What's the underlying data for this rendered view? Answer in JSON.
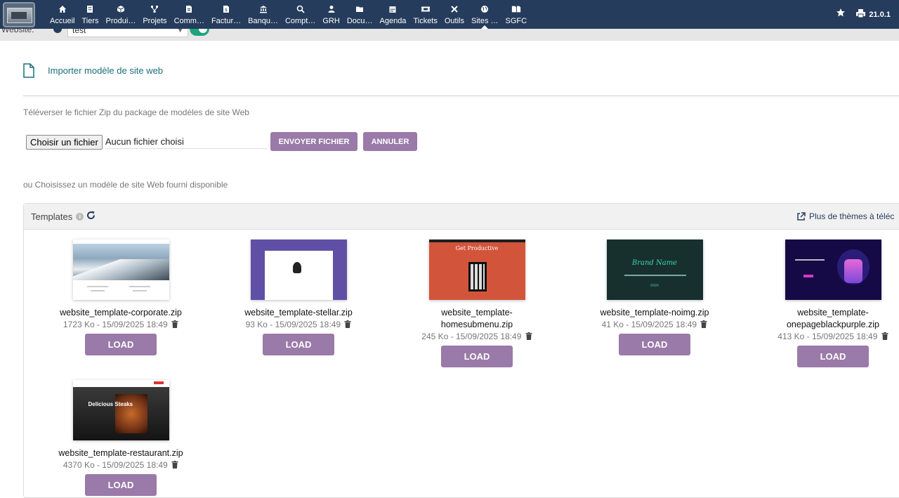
{
  "menu": [
    {
      "label": "Accueil",
      "icon": "home-icon"
    },
    {
      "label": "Tiers",
      "icon": "building-icon"
    },
    {
      "label": "Produi…",
      "icon": "cube-icon"
    },
    {
      "label": "Projets",
      "icon": "sitemap-icon"
    },
    {
      "label": "Comm…",
      "icon": "file-invoice-icon"
    },
    {
      "label": "Factur…",
      "icon": "file-dollar-icon"
    },
    {
      "label": "Banqu…",
      "icon": "bank-icon"
    },
    {
      "label": "Compt…",
      "icon": "search-dollar-icon"
    },
    {
      "label": "GRH",
      "icon": "user-icon"
    },
    {
      "label": "Docu…",
      "icon": "folder-icon"
    },
    {
      "label": "Agenda",
      "icon": "calendar-icon"
    },
    {
      "label": "Tickets",
      "icon": "ticket-icon"
    },
    {
      "label": "Outils",
      "icon": "tools-icon"
    },
    {
      "label": "Sites …",
      "icon": "globe-icon"
    },
    {
      "label": "SGFC",
      "icon": "files-icon"
    }
  ],
  "active_menu": "Sites …",
  "topright": {
    "version": "21.0.1"
  },
  "subbar": {
    "website_label": "Website:",
    "website_value": "test"
  },
  "page": {
    "title": "Importer modèle de site web",
    "upload_hint": "Téléverser le fichier Zip du package de modèles de site Web",
    "file_button": "Choisir un fichier",
    "file_status": "Aucun fichier choisi",
    "send_button": "ENVOYER FICHIER",
    "cancel_button": "ANNULER",
    "choose_hint": "ou Choisissez un modèle de site Web fourni disponible"
  },
  "templates": {
    "header": "Templates",
    "more_themes": "Plus de thèmes à téléc",
    "load_label": "LOAD",
    "items": [
      {
        "name": "website_template-corporate.zip",
        "meta": "1723 Ko - 15/09/2025 18:49",
        "thumb": "corporate"
      },
      {
        "name": "website_template-stellar.zip",
        "meta": "93 Ko - 15/09/2025 18:49",
        "thumb": "stellar"
      },
      {
        "name": "website_template-homesubmenu.zip",
        "meta": "245 Ko - 15/09/2025 18:49",
        "thumb": "homesubmenu",
        "thumb_text": "Get Productive"
      },
      {
        "name": "website_template-noimg.zip",
        "meta": "41 Ko - 15/09/2025 18:49",
        "thumb": "noimg",
        "thumb_text": "Brand Name"
      },
      {
        "name": "website_template-onepageblackpurple.zip",
        "name_line1": "website_template-",
        "name_line2": "onepageblackpurple.zip",
        "meta": "413 Ko - 15/09/2025 18:49",
        "thumb": "purple"
      },
      {
        "name": "website_template-restaurant.zip",
        "meta": "4370 Ko - 15/09/2025 18:49",
        "thumb": "restaurant",
        "thumb_text": "Delicious Steaks"
      }
    ]
  }
}
